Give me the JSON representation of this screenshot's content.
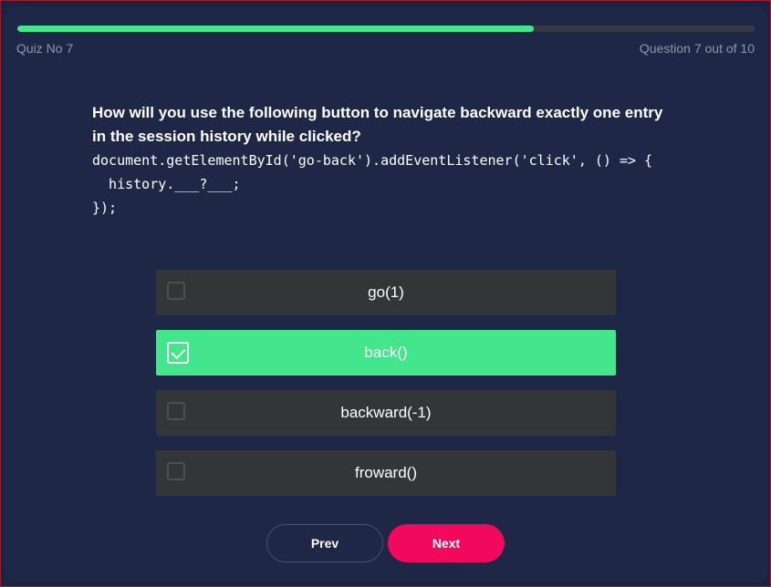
{
  "header": {
    "quiz_label": "Quiz No 7",
    "question_count": "Question 7 out of 10",
    "progress": 0.7
  },
  "question": {
    "text": "How will you use the following button to navigate backward exactly one entry in the session history while clicked?",
    "code": "document.getElementById('go-back').addEventListener('click', () => {\n  history.___?___;\n});"
  },
  "options": [
    {
      "label": "go(1)",
      "selected": false
    },
    {
      "label": "back()",
      "selected": true
    },
    {
      "label": "backward(-1)",
      "selected": false
    },
    {
      "label": "froward()",
      "selected": false
    }
  ],
  "navigation": {
    "prev_label": "Prev",
    "next_label": "Next"
  },
  "colors": {
    "accent_green": "#43e68a",
    "next_button": "#f0095d",
    "progress_fill": "#43e68a"
  }
}
